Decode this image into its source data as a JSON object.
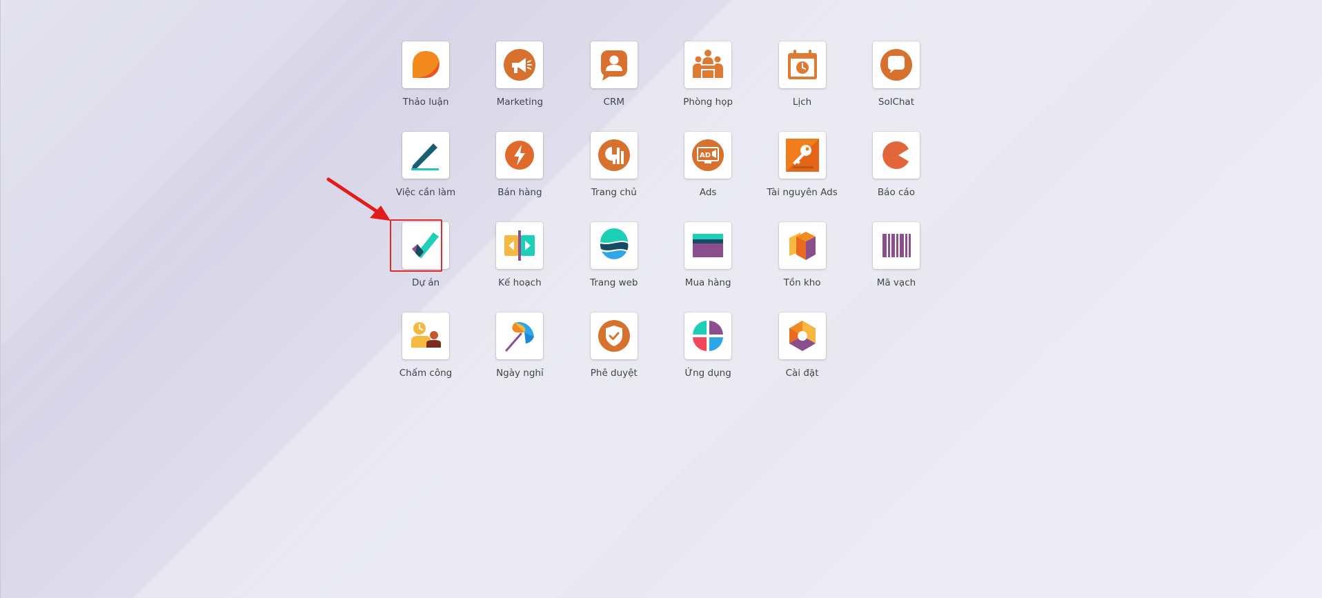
{
  "apps": [
    {
      "name": "Thảo luận",
      "icon": "discuss-icon"
    },
    {
      "name": "Marketing",
      "icon": "marketing-megaphone-icon"
    },
    {
      "name": "CRM",
      "icon": "crm-contact-icon"
    },
    {
      "name": "Phòng họp",
      "icon": "meeting-room-icon"
    },
    {
      "name": "Lịch",
      "icon": "calendar-icon"
    },
    {
      "name": "SolChat",
      "icon": "chat-bubble-icon"
    },
    {
      "name": "Việc cần làm",
      "icon": "todo-pen-icon"
    },
    {
      "name": "Bán hàng",
      "icon": "sales-bolt-icon"
    },
    {
      "name": "Trang chủ",
      "icon": "dashboard-chart-icon"
    },
    {
      "name": "Ads",
      "icon": "ads-monitor-icon"
    },
    {
      "name": "Tài nguyên Ads",
      "icon": "ads-key-icon"
    },
    {
      "name": "Báo cáo",
      "icon": "report-pie-icon"
    },
    {
      "name": "Dự án",
      "icon": "project-check-icon"
    },
    {
      "name": "Kế hoạch",
      "icon": "planning-icon"
    },
    {
      "name": "Trang web",
      "icon": "website-icon"
    },
    {
      "name": "Mua hàng",
      "icon": "purchase-card-icon"
    },
    {
      "name": "Tồn kho",
      "icon": "inventory-box-icon"
    },
    {
      "name": "Mã vạch",
      "icon": "barcode-icon"
    },
    {
      "name": "Chấm công",
      "icon": "attendance-icon"
    },
    {
      "name": "Ngày nghỉ",
      "icon": "time-off-umbrella-icon"
    },
    {
      "name": "Phê duyệt",
      "icon": "approval-shield-icon"
    },
    {
      "name": "Ứng dụng",
      "icon": "apps-icon"
    },
    {
      "name": "Cài đặt",
      "icon": "settings-icon"
    }
  ],
  "highlighted_app": "Dự án",
  "colors": {
    "orange": "#e0772f",
    "teal": "#1ccfb6",
    "purple": "#8a4f8c",
    "highlight_red": "#e02a2a"
  }
}
